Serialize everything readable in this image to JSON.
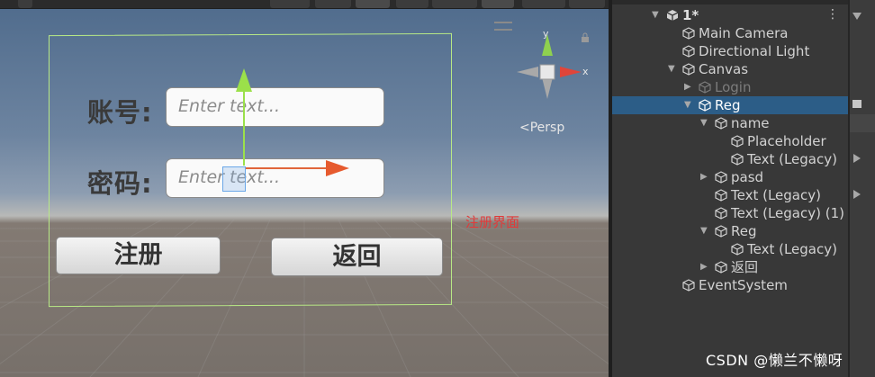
{
  "scene_view": {
    "form": {
      "account_label": "账号:",
      "account_placeholder": "Enter text...",
      "password_label": "密码:",
      "password_placeholder": "Enter text...",
      "register_button": "注册",
      "back_button": "返回"
    },
    "overlay_label": "注册界面",
    "gizmo": {
      "y_label": "y",
      "x_label": "x",
      "projection": "<Persp"
    }
  },
  "hierarchy": {
    "items": [
      {
        "label": "1*",
        "depth": 0,
        "arrow": "▼"
      },
      {
        "label": "Main Camera",
        "depth": 1
      },
      {
        "label": "Directional Light",
        "depth": 1
      },
      {
        "label": "Canvas",
        "depth": 1,
        "arrow": "▼"
      },
      {
        "label": "Login",
        "depth": 2,
        "arrow": "▶",
        "dim": true
      },
      {
        "label": "Reg",
        "depth": 2,
        "arrow": "▼",
        "selected": true
      },
      {
        "label": "name",
        "depth": 3,
        "arrow": "▼"
      },
      {
        "label": "Placeholder",
        "depth": 4
      },
      {
        "label": "Text (Legacy)",
        "depth": 4
      },
      {
        "label": "pasd",
        "depth": 3,
        "arrow": "▶"
      },
      {
        "label": "Text (Legacy)",
        "depth": 3
      },
      {
        "label": "Text (Legacy) (1)",
        "depth": 3
      },
      {
        "label": "Reg",
        "depth": 3,
        "arrow": "▼"
      },
      {
        "label": "Text (Legacy)",
        "depth": 4
      },
      {
        "label": "返回",
        "depth": 3,
        "arrow": "▶"
      },
      {
        "label": "EventSystem",
        "depth": 1
      }
    ]
  },
  "watermark": "CSDN @懒兰不懒呀",
  "colors": {
    "selection": "#2c5d87",
    "canvas_outline": "#b8e986",
    "overlay_text": "#e03a3a"
  }
}
